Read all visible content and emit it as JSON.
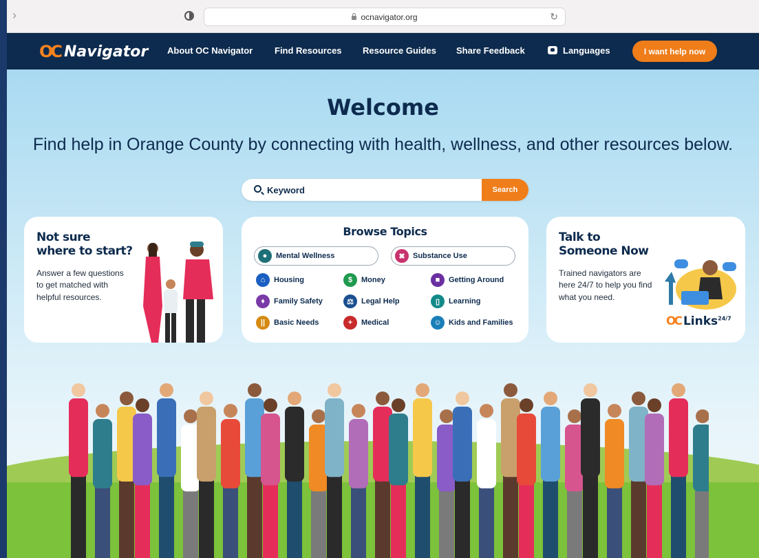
{
  "browser": {
    "url": "ocnavigator.org"
  },
  "nav": {
    "logo_text": "Navigator",
    "logo_mark": "OC",
    "links": [
      "About OC Navigator",
      "Find Resources",
      "Resource Guides",
      "Share Feedback",
      "Languages"
    ],
    "help_button": "I want help now"
  },
  "hero": {
    "title": "Welcome",
    "subtitle": "Find help in Orange County by connecting with health, wellness, and other resources below."
  },
  "search": {
    "placeholder": "Keyword",
    "button": "Search"
  },
  "start_card": {
    "title": "Not sure where to start?",
    "body": "Answer a few questions to get matched with helpful resources."
  },
  "browse": {
    "title": "Browse Topics",
    "featured": [
      {
        "label": "Mental Wellness",
        "color": "#1e6f78",
        "icon": "head-icon"
      },
      {
        "label": "Substance Use",
        "color": "#c8336e",
        "icon": "pills-icon"
      }
    ],
    "topics": [
      {
        "label": "Housing",
        "color": "#1b5fc2",
        "icon": "house-icon"
      },
      {
        "label": "Money",
        "color": "#1f9a4e",
        "icon": "dollar-icon"
      },
      {
        "label": "Getting Around",
        "color": "#6b2fa0",
        "icon": "bus-icon"
      },
      {
        "label": "Family Safety",
        "color": "#7a3aa8",
        "icon": "shield-icon"
      },
      {
        "label": "Legal Help",
        "color": "#1b4f8f",
        "icon": "scales-icon"
      },
      {
        "label": "Learning",
        "color": "#138a8a",
        "icon": "book-icon"
      },
      {
        "label": "Basic Needs",
        "color": "#d58a12",
        "icon": "utensils-icon"
      },
      {
        "label": "Medical",
        "color": "#c82b2b",
        "icon": "cross-icon"
      },
      {
        "label": "Kids and Families",
        "color": "#1a7fb8",
        "icon": "child-icon"
      }
    ]
  },
  "talk_card": {
    "title": "Talk to Someone Now",
    "body": "Trained navigators are here 24/7 to help you find what you need.",
    "logo_text": "Links",
    "logo_sup": "24/7"
  },
  "colors": {
    "navy": "#0d2b4e",
    "orange": "#ef7d1a",
    "sky": "#a9daf1",
    "grass": "#7cc23a"
  }
}
